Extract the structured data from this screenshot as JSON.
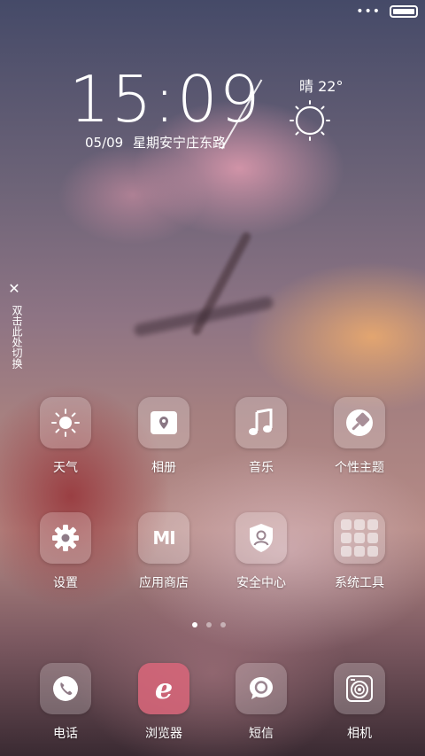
{
  "clock": {
    "time": "15:09",
    "date": "05/09",
    "day_location": "星期安宁庄东路"
  },
  "weather": {
    "summary": "晴 22°",
    "icon": "sun-icon"
  },
  "side_hint": {
    "text": "双击此处切换",
    "icon": "close-icon"
  },
  "apps": [
    {
      "label": "天气",
      "icon": "weather-sun-icon"
    },
    {
      "label": "相册",
      "icon": "gallery-icon"
    },
    {
      "label": "音乐",
      "icon": "music-note-icon"
    },
    {
      "label": "个性主题",
      "icon": "themes-brush-icon"
    },
    {
      "label": "设置",
      "icon": "gear-icon"
    },
    {
      "label": "应用商店",
      "icon": "mi-store-icon",
      "glyph": "MI"
    },
    {
      "label": "安全中心",
      "icon": "security-shield-icon"
    },
    {
      "label": "系统工具",
      "icon": "folder-tools-icon"
    }
  ],
  "dock": [
    {
      "label": "电话",
      "icon": "phone-icon"
    },
    {
      "label": "浏览器",
      "icon": "browser-icon",
      "glyph": "e"
    },
    {
      "label": "短信",
      "icon": "message-bubble-icon"
    },
    {
      "label": "相机",
      "icon": "camera-icon"
    }
  ],
  "pager": {
    "pages": 3,
    "current": 1
  },
  "colors": {
    "accent": "#ffffff",
    "browser_tile": "#d9667a",
    "wallpaper_top": "#454a68"
  }
}
